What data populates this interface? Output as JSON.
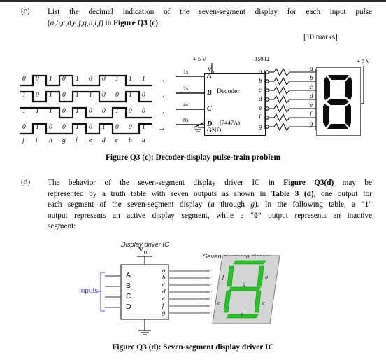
{
  "part_c": {
    "label": "(c)",
    "text_1": "List the decimal indication of the seven-segment display for each input pulse",
    "text_2_pre": "(",
    "text_2_italic": "a,b,c,d,e,f,g,h,i,j",
    "text_2_mid": ") in ",
    "text_2_bold": "Figure Q3 (c)",
    "text_2_end": ".",
    "marks": "[10 marks]"
  },
  "part_d": {
    "label": "(d)",
    "line1_a": "The behavior of the seven-segment display driver IC in ",
    "line1_b": "Figure Q3(d)",
    "line1_c": " may be",
    "line2_a": "represented by a truth table with seven outputs as shown in ",
    "line2_b": "Table 3 (d)",
    "line2_c": ", one output for",
    "line3_a": "each segment of the seven-segment display (",
    "line3_b": "a",
    "line3_c": " through ",
    "line3_d": "g",
    "line3_e": "). In the following table, a “",
    "line3_f": "1",
    "line3_g": "”",
    "line4_a": "output represents an active display segment, while a “",
    "line4_b": "0",
    "line4_c": "” output represents an inactive",
    "line5": "segment:"
  },
  "figure_c": {
    "caption": "Figure Q3 (c): Decoder-display pulse-train problem",
    "supply_left": "+ 5 V",
    "supply_right": "+ 5 V",
    "vcc": "V",
    "vcc_sub": "cc",
    "resistor_value": "150 Ω",
    "decoder_title": "Decoder",
    "decoder_part": "(7447A)",
    "gnd": "GND",
    "weight_labels": [
      "1s",
      "2s",
      "4s",
      "8s"
    ],
    "input_pins": [
      "A",
      "B",
      "C",
      "D"
    ],
    "output_pins": [
      "a",
      "b",
      "c",
      "d",
      "e",
      "f",
      "g"
    ],
    "segment_labels": [
      "a",
      "b",
      "c",
      "d",
      "e",
      "f",
      "g"
    ],
    "pulse_labels": [
      "j",
      "i",
      "h",
      "g",
      "f",
      "e",
      "d",
      "c",
      "b",
      "a"
    ],
    "arrows": [
      "→",
      "→",
      "→",
      "→"
    ],
    "waveforms": [
      {
        "name": "A",
        "weight": "1s",
        "bits": [
          0,
          0,
          1,
          0,
          1,
          0,
          0,
          1,
          1,
          1
        ]
      },
      {
        "name": "B",
        "weight": "2s",
        "bits": [
          1,
          0,
          1,
          0,
          1,
          1,
          0,
          0,
          1,
          0
        ]
      },
      {
        "name": "C",
        "weight": "4s",
        "bits": [
          1,
          1,
          1,
          0,
          1,
          0,
          0,
          1,
          0,
          0
        ]
      },
      {
        "name": "D",
        "weight": "8s",
        "bits": [
          0,
          1,
          0,
          0,
          1,
          0,
          1,
          0,
          0,
          1
        ]
      }
    ],
    "display_segments_on": [
      "a",
      "b",
      "c",
      "d",
      "e",
      "f",
      "g"
    ]
  },
  "figure_d": {
    "caption": "Figure Q3 (d): Seven-segment display driver IC",
    "driver_title": "Display driver IC",
    "display_title": "Seven-segment display",
    "vdd": "V",
    "vdd_sub": "DD",
    "inputs_label": "Inputs",
    "input_pins": [
      "A",
      "B",
      "C",
      "D"
    ],
    "output_pins": [
      "a",
      "b",
      "c",
      "d",
      "e",
      "f",
      "g"
    ],
    "segment_labels": [
      "a",
      "b",
      "c",
      "d",
      "e",
      "f",
      "g"
    ],
    "dots": "· · ·",
    "segment_color": "#1ec81e"
  }
}
